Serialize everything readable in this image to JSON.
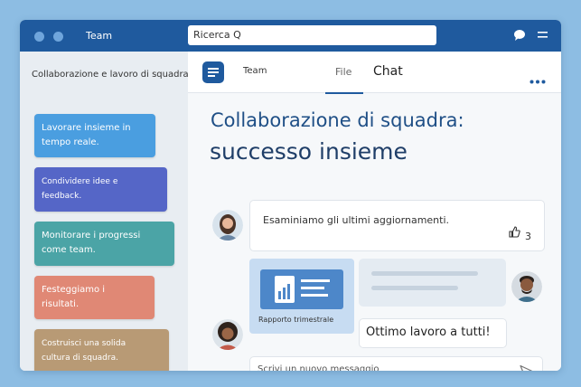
{
  "titlebar": {
    "app_name": "Team",
    "search_value": "Ricerca Q"
  },
  "sidebar": {
    "title": "Collaborazione e lavoro di squadra",
    "cards": [
      {
        "line1": "Lavorare insieme in",
        "line2": "tempo reale.",
        "color": "#4a9ee0"
      },
      {
        "line1": "Condividere idee e",
        "line2": "feedback.",
        "color": "#5566c7"
      },
      {
        "line1": "Monitorare i progressi",
        "line2": "come team.",
        "color": "#4ba4a6"
      },
      {
        "line1": "Festeggiamo i",
        "line2": "risultati.",
        "color": "#e08875"
      },
      {
        "line1": "Costruisci una solida",
        "line2": "cultura di squadra.",
        "color": "#b89a75"
      }
    ]
  },
  "header": {
    "team_label": "Team",
    "tabs": {
      "file": "File",
      "chat": "Chat"
    }
  },
  "main": {
    "headline1": "Collaborazione di squadra:",
    "headline2": "successo insieme",
    "message1": {
      "text": "Esaminiamo gli ultimi aggiornamenti.",
      "likes": "3"
    },
    "file_card": {
      "caption": "Rapporto trimestrale"
    },
    "message3": {
      "text": "Ottimo lavoro a tutti!"
    },
    "composer": {
      "placeholder": "Scrivi un nuovo messaggio"
    }
  },
  "colors": {
    "accent": "#1f5a9e",
    "titlebar": "#1f5a9e",
    "background": "#8dbde3"
  },
  "icons": [
    "chat-bubble-icon",
    "menu-icon",
    "team-icon",
    "more-icon",
    "thumbs-up-icon",
    "document-chart-icon",
    "send-icon"
  ]
}
